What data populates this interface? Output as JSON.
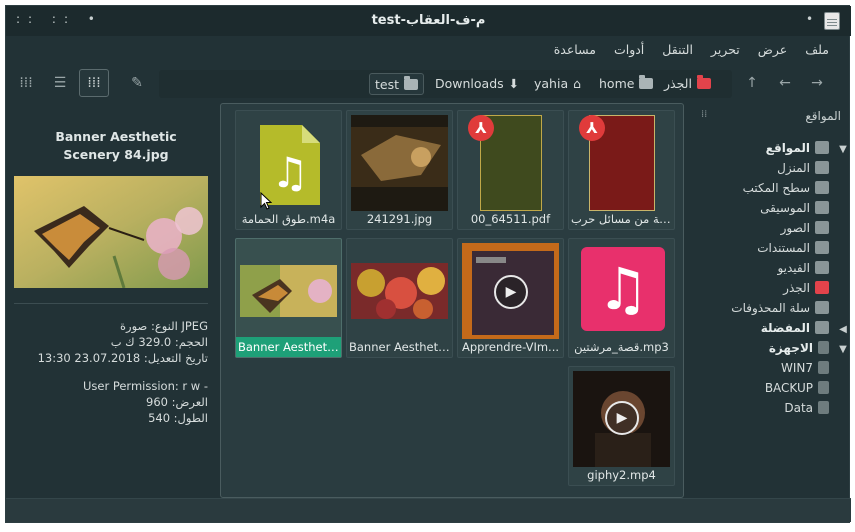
{
  "window": {
    "title": "test-م-ف-العقاب"
  },
  "titlebar": {
    "left_controls": "::  ::  •",
    "right_dot": "•"
  },
  "menubar": [
    "ملف",
    "عرض",
    "تحرير",
    "التنقل",
    "أدوات",
    "مساعدة"
  ],
  "toolbar": {
    "view_compact": "⁞⁞⁞",
    "view_list": "☰",
    "view_icons": "⁞⁞⁞",
    "edit": "✎",
    "nav_up": "↑",
    "nav_back": "←",
    "nav_forward": "→"
  },
  "breadcrumb": {
    "root": "الجذر",
    "home": "home",
    "yahia": "yahia",
    "downloads": "Downloads",
    "test": "test"
  },
  "sidebar": {
    "title": "المواقع",
    "sections": [
      {
        "label": "المواقع",
        "expanded": true
      },
      {
        "label": "المفضلة",
        "expanded": false
      },
      {
        "label": "الاجهزة",
        "expanded": true
      }
    ],
    "places": [
      "المنزل",
      "سطح المكتب",
      "الموسيقى",
      "الصور",
      "المستندات",
      "الفيديو",
      "الجذر",
      "سلة المحذوفات"
    ],
    "devices": [
      "WIN7",
      "BACKUP",
      "Data"
    ]
  },
  "files": [
    {
      "name": "السنة من مسائل حرب...",
      "type": "pdf"
    },
    {
      "name": "00_64511.pdf",
      "type": "pdf"
    },
    {
      "name": "241291.jpg",
      "type": "image"
    },
    {
      "name": "طوق الحمامة.m4a",
      "type": "audio"
    },
    {
      "name": "قصة_مرشتين.mp3",
      "type": "audio"
    },
    {
      "name": "Apprendre-VIm...",
      "type": "video"
    },
    {
      "name": "Banner Aestheti...",
      "type": "image"
    },
    {
      "name": "Banner Aestheti...",
      "type": "image",
      "selected": true
    },
    {
      "name": "giphy2.mp4",
      "type": "video"
    }
  ],
  "preview": {
    "filename": "Banner Aesthetic Scenery 84.jpg",
    "type_line": "النوع: صورة JPEG",
    "size_line": "الحجم: 329.0 ك ب",
    "modified_line": "تاريخ التعديل: 23.07.2018 13:30",
    "permission_line": "User Permission: r  w  -",
    "width_line": "العرض: 960",
    "height_line": "الطول: 540"
  },
  "colors": {
    "window_bg": "#223236",
    "selection": "#1ea078",
    "pdf_red": "#e03b3b",
    "root_folder": "#e2434b",
    "audio_yellow": "#b5bb2a",
    "audio_pink": "#e8306c"
  }
}
